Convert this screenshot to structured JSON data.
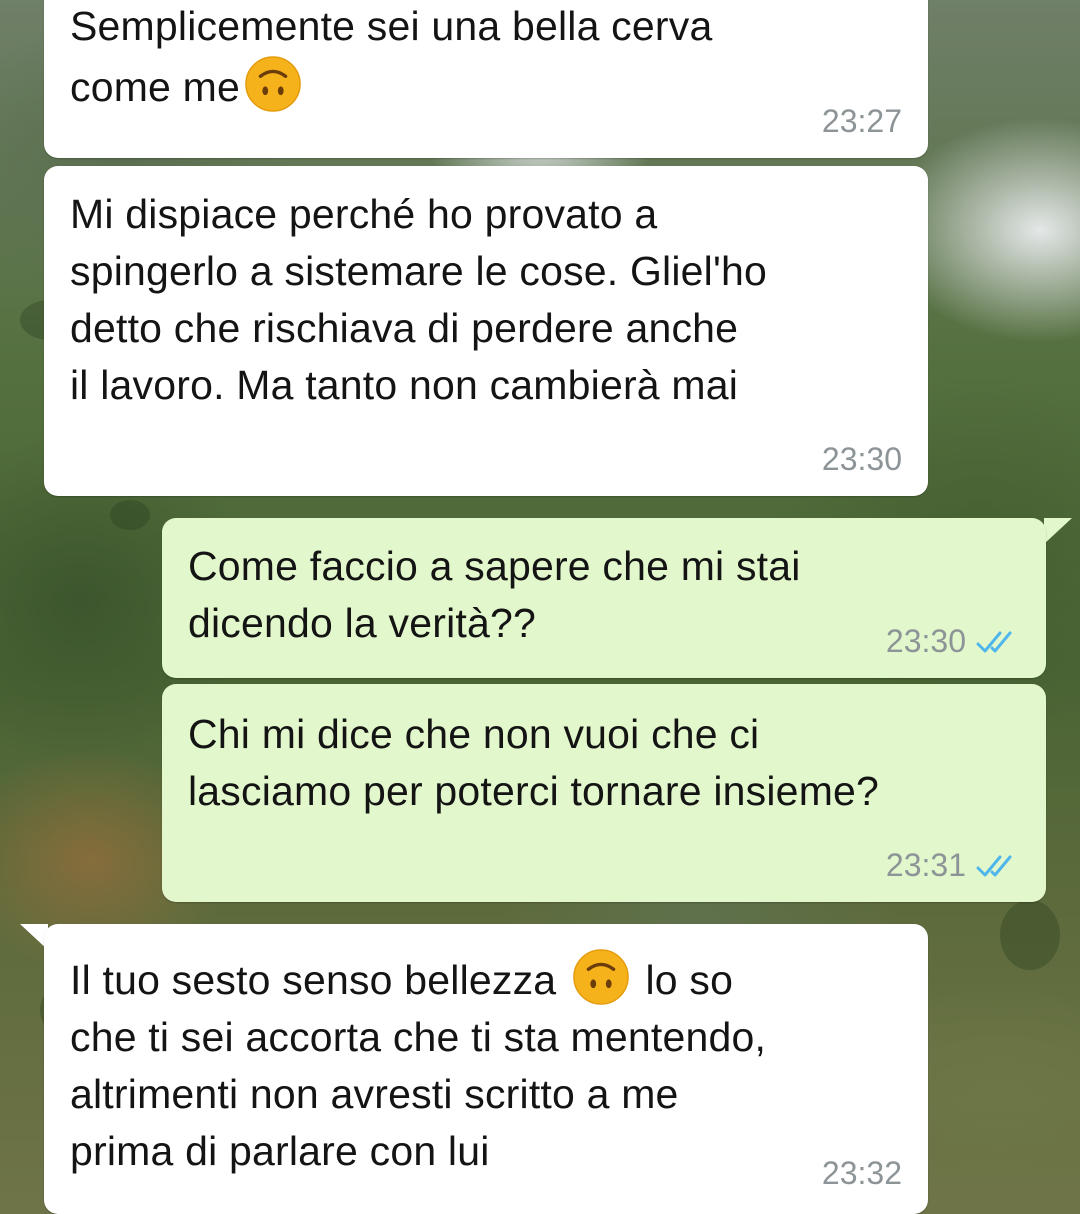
{
  "chat": {
    "messages": [
      {
        "direction": "incoming",
        "text_before_emoji": "Semplicemente sei una bella cerva\ncome me",
        "emoji": "upside-down-face-emoji",
        "text_after_emoji": "",
        "time": "23:27"
      },
      {
        "direction": "incoming",
        "text": "Mi dispiace perché ho provato a\nspingerlo a sistemare le cose. Gliel'ho\ndetto che rischiava di perdere anche\nil lavoro. Ma tanto non cambierà mai",
        "time": "23:30"
      },
      {
        "direction": "outgoing",
        "text": "Come faccio a sapere che mi stai\ndicendo la verità??",
        "time": "23:30",
        "status": "read-double-check-icon"
      },
      {
        "direction": "outgoing",
        "text": "Chi mi dice che non vuoi che ci\nlasciamo per poterci tornare insieme?",
        "time": "23:31",
        "status": "read-double-check-icon"
      },
      {
        "direction": "incoming",
        "text_before_emoji": "Il tuo sesto senso bellezza ",
        "emoji": "upside-down-face-emoji",
        "text_after_emoji": " lo so\nche ti sei accorta che ti sta mentendo,\naltrimenti non avresti scritto a me\nprima di parlare con lui",
        "time": "23:32"
      }
    ]
  },
  "colors": {
    "incoming_bubble": "#ffffff",
    "outgoing_bubble": "#e2f7cb",
    "timestamp": "#8d9497",
    "read_ticks": "#4fb6ec"
  }
}
